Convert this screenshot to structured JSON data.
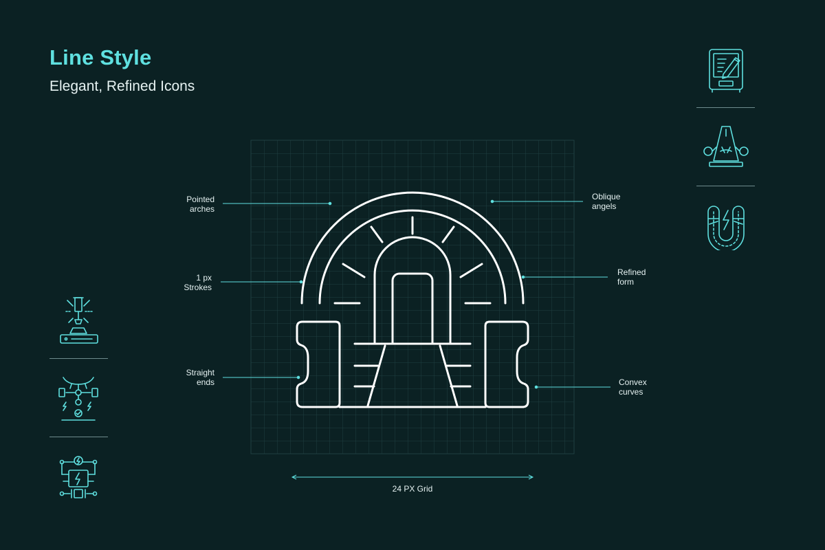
{
  "header": {
    "title": "Line Style",
    "subtitle": "Elegant, Refined Icons"
  },
  "annotations": {
    "pointed_arches": "Pointed\narches",
    "strokes": "1 px\nStrokes",
    "straight_ends": "Straight\nends",
    "oblique_angels": "Oblique\nangels",
    "refined_form": "Refined\nform",
    "convex_curves": "Convex\ncurves"
  },
  "grid_caption": "24 PX Grid",
  "side_icons": {
    "left": [
      "laser-machine-icon",
      "robot-arm-circuit-icon",
      "power-circuit-board-icon"
    ],
    "right": [
      "tablet-pencil-icon",
      "metronome-icon",
      "magnet-energy-icon"
    ]
  },
  "colors": {
    "background": "#0b2123",
    "accent": "#5fe0e0",
    "text": "#e6f2f2",
    "stroke": "#ffffff",
    "grid": "#1f4042"
  }
}
